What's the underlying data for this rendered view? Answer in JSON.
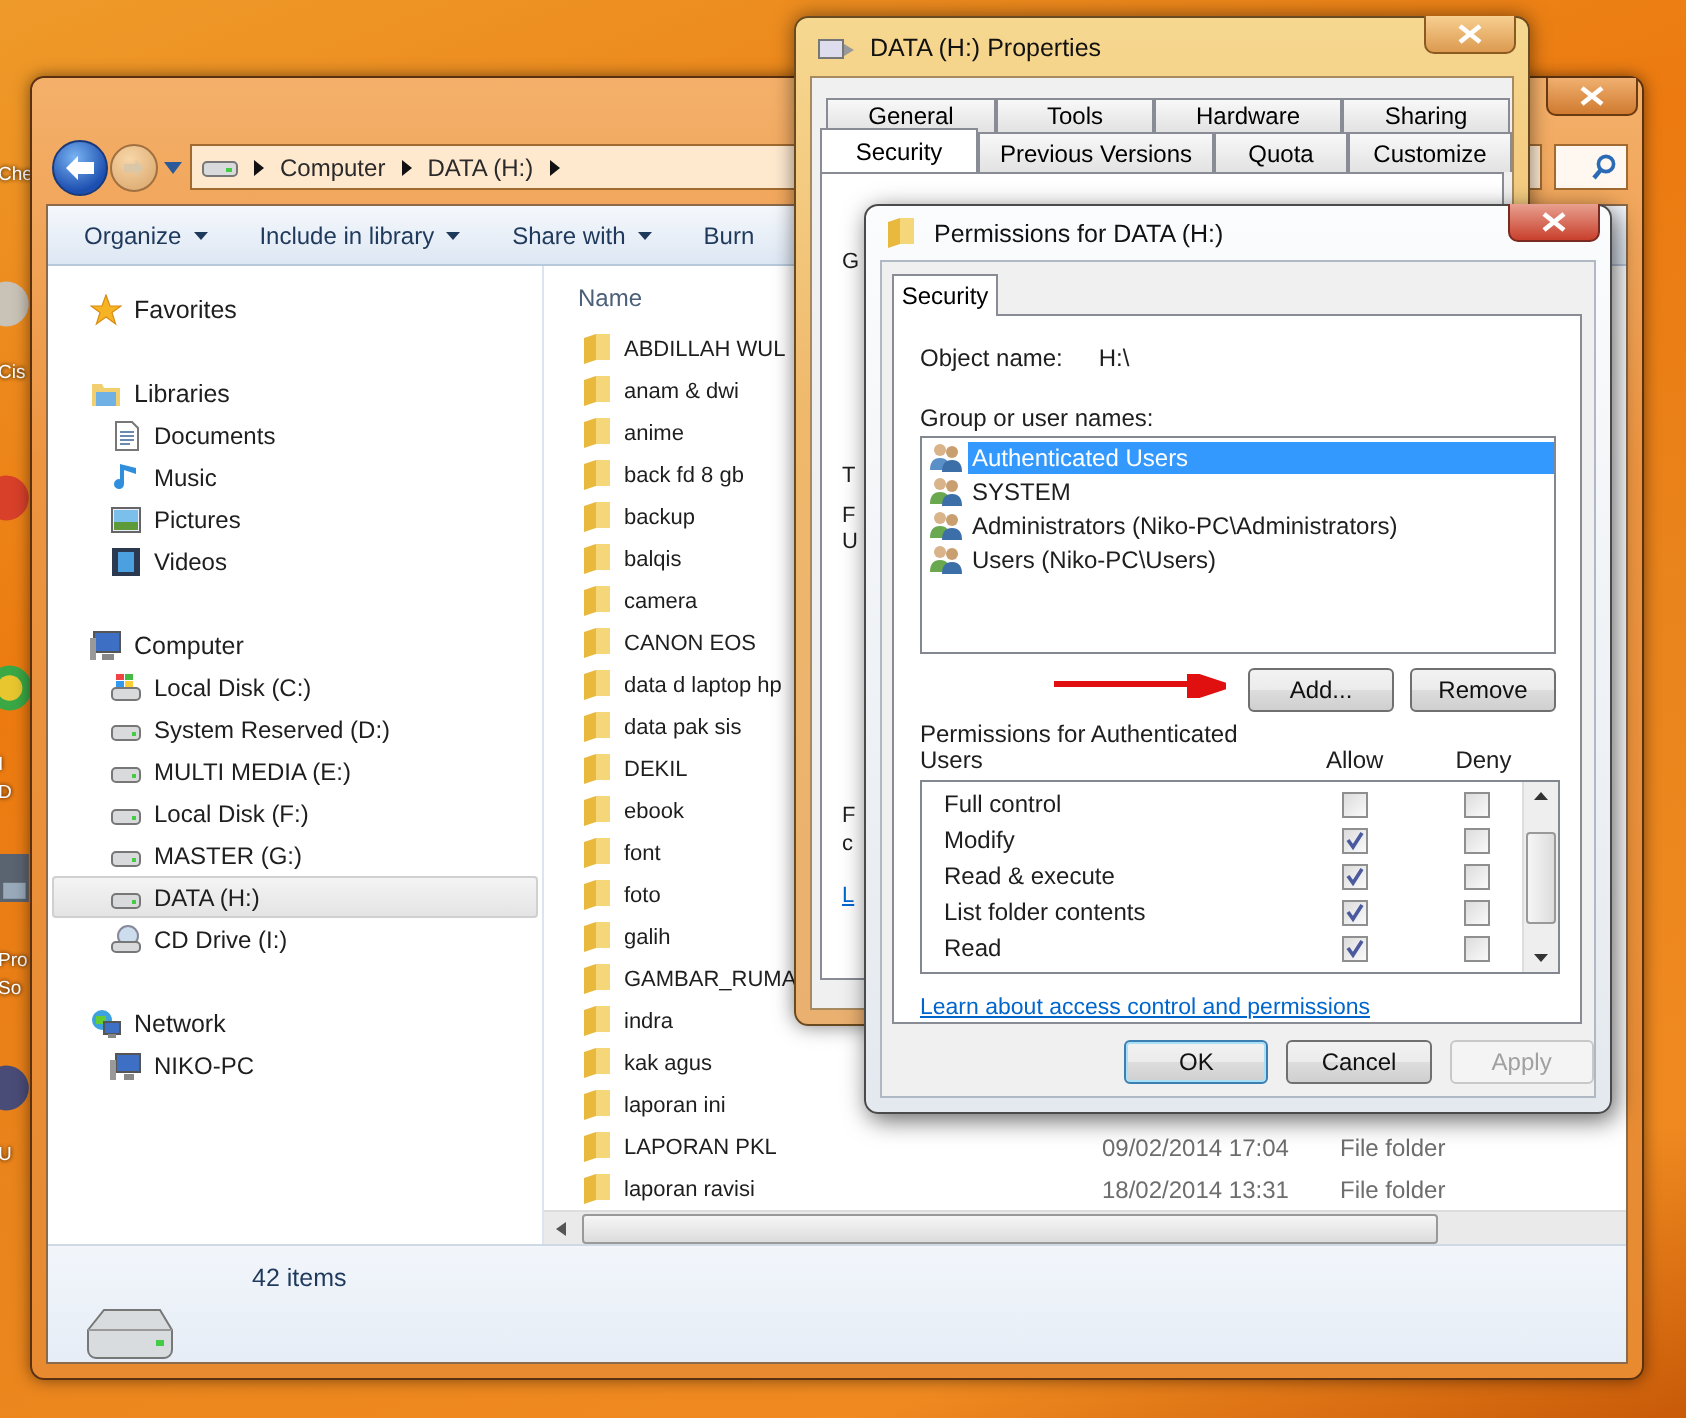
{
  "desktop": {
    "icon_labels": [
      "Che",
      "Cis",
      "I",
      "D",
      "Pro",
      "So",
      "U"
    ]
  },
  "explorer": {
    "breadcrumb": [
      "Computer",
      "DATA (H:)"
    ],
    "toolbar": [
      {
        "label": "Organize",
        "dropdown": true
      },
      {
        "label": "Include in library",
        "dropdown": true
      },
      {
        "label": "Share with",
        "dropdown": true
      },
      {
        "label": "Burn",
        "dropdown": false
      }
    ],
    "nav": [
      {
        "label": "Favorites",
        "kind": "star",
        "selected": false
      },
      {
        "label": "Libraries",
        "kind": "library",
        "selected": false,
        "children": [
          {
            "label": "Documents",
            "kind": "document",
            "selected": false
          },
          {
            "label": "Music",
            "kind": "music",
            "selected": false
          },
          {
            "label": "Pictures",
            "kind": "picture",
            "selected": false
          },
          {
            "label": "Videos",
            "kind": "video",
            "selected": false
          }
        ]
      },
      {
        "label": "Computer",
        "kind": "computer",
        "selected": false,
        "children": [
          {
            "label": "Local Disk (C:)",
            "kind": "system-drive",
            "selected": false
          },
          {
            "label": "System Reserved (D:)",
            "kind": "drive",
            "selected": false
          },
          {
            "label": "MULTI MEDIA (E:)",
            "kind": "drive",
            "selected": false
          },
          {
            "label": "Local Disk (F:)",
            "kind": "drive",
            "selected": false
          },
          {
            "label": "MASTER (G:)",
            "kind": "drive",
            "selected": false
          },
          {
            "label": "DATA (H:)",
            "kind": "drive",
            "selected": true
          },
          {
            "label": "CD Drive (I:)",
            "kind": "cd",
            "selected": false
          }
        ]
      },
      {
        "label": "Network",
        "kind": "network",
        "selected": false,
        "children": [
          {
            "label": "NIKO-PC",
            "kind": "computer",
            "selected": false
          }
        ]
      }
    ],
    "columns": [
      "Name"
    ],
    "files": [
      {
        "name": "ABDILLAH WUL"
      },
      {
        "name": "anam & dwi"
      },
      {
        "name": "anime"
      },
      {
        "name": "back fd 8 gb"
      },
      {
        "name": "backup"
      },
      {
        "name": "balqis"
      },
      {
        "name": "camera"
      },
      {
        "name": "CANON EOS"
      },
      {
        "name": "data d laptop hp"
      },
      {
        "name": "data pak sis"
      },
      {
        "name": "DEKIL"
      },
      {
        "name": "ebook"
      },
      {
        "name": "font"
      },
      {
        "name": "foto"
      },
      {
        "name": "galih"
      },
      {
        "name": "GAMBAR_RUMA"
      },
      {
        "name": "indra"
      },
      {
        "name": "kak agus"
      },
      {
        "name": "laporan ini"
      },
      {
        "name": "LAPORAN PKL",
        "date": "09/02/2014 17:04",
        "type": "File folder"
      },
      {
        "name": "laporan ravisi",
        "date": "18/02/2014 13:31",
        "type": "File folder"
      }
    ],
    "status": "42 items"
  },
  "properties": {
    "title": "DATA (H:) Properties",
    "tab_rows": [
      [
        {
          "label": "General",
          "selected": false
        },
        {
          "label": "Tools",
          "selected": false
        },
        {
          "label": "Hardware",
          "selected": false
        },
        {
          "label": "Sharing",
          "selected": false
        }
      ],
      [
        {
          "label": "Security",
          "selected": true
        },
        {
          "label": "Previous Versions",
          "selected": false
        },
        {
          "label": "Quota",
          "selected": false
        },
        {
          "label": "Customize",
          "selected": false
        }
      ]
    ],
    "fragments": [
      {
        "text": "G",
        "kind": "text"
      },
      {
        "text": "T",
        "kind": "text"
      },
      {
        "text": "F",
        "kind": "text"
      },
      {
        "text": "U",
        "kind": "text"
      },
      {
        "text": "F",
        "kind": "text"
      },
      {
        "text": "c",
        "kind": "text"
      },
      {
        "text": "L",
        "kind": "link"
      }
    ]
  },
  "permissions": {
    "title": "Permissions for DATA (H:)",
    "tab": {
      "label": "Security",
      "selected": true
    },
    "object_label": "Object name:",
    "object_name": "H:\\",
    "group_label": "Group or user names:",
    "users": [
      {
        "name": "Authenticated Users",
        "selected": true
      },
      {
        "name": "SYSTEM",
        "selected": false
      },
      {
        "name": "Administrators (Niko-PC\\Administrators)",
        "selected": false
      },
      {
        "name": "Users (Niko-PC\\Users)",
        "selected": false
      }
    ],
    "user_buttons": [
      "Add...",
      "Remove"
    ],
    "perm_label": "Permissions for Authenticated Users",
    "allow_label": "Allow",
    "deny_label": "Deny",
    "permissions": [
      {
        "name": "Full control",
        "allow": false,
        "deny": false
      },
      {
        "name": "Modify",
        "allow": true,
        "deny": false
      },
      {
        "name": "Read & execute",
        "allow": true,
        "deny": false
      },
      {
        "name": "List folder contents",
        "allow": true,
        "deny": false
      },
      {
        "name": "Read",
        "allow": true,
        "deny": false
      }
    ],
    "link": "Learn about access control and permissions",
    "buttons": [
      {
        "label": "OK",
        "kind": "default",
        "disabled": false
      },
      {
        "label": "Cancel",
        "kind": "normal",
        "disabled": false
      },
      {
        "label": "Apply",
        "kind": "normal",
        "disabled": true
      }
    ]
  }
}
